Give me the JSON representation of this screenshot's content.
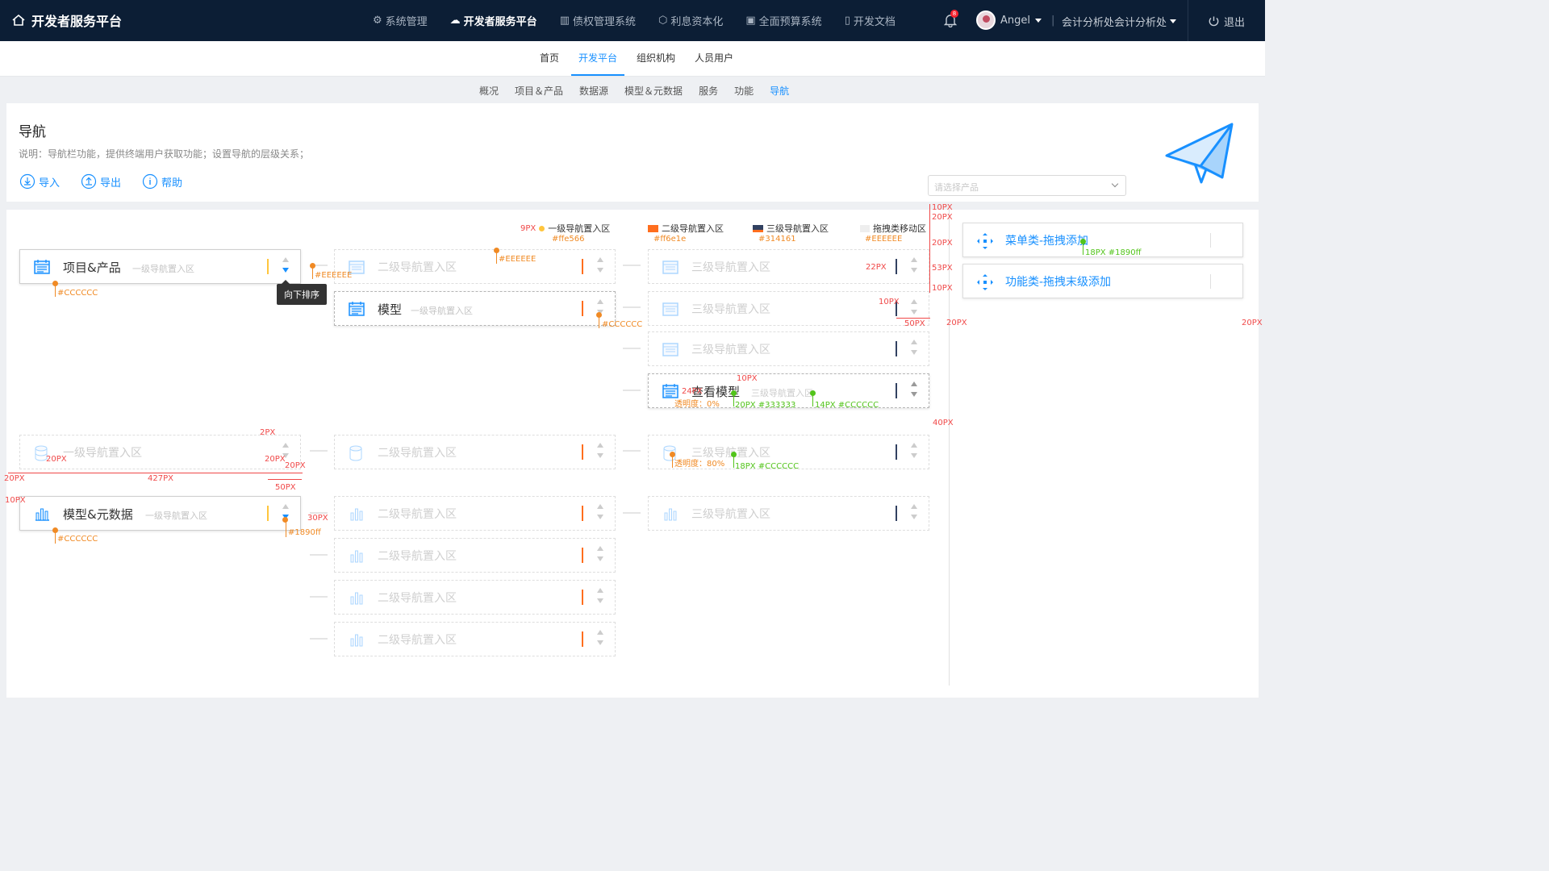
{
  "app": {
    "title": "开发者服务平台",
    "notif_count": "8",
    "user": "Angel",
    "org": "会计分析处会计分析处",
    "logout": "退出",
    "nav": [
      {
        "label": "系统管理",
        "icon": "gear-icon"
      },
      {
        "label": "开发者服务平台",
        "icon": "cloud-icon",
        "active": true
      },
      {
        "label": "债权管理系统",
        "icon": "building-icon"
      },
      {
        "label": "利息资本化",
        "icon": "cube-icon"
      },
      {
        "label": "全面预算系统",
        "icon": "box-icon"
      },
      {
        "label": "开发文档",
        "icon": "document-icon"
      }
    ]
  },
  "subnav1": [
    "首页",
    "开发平台",
    "组织机构",
    "人员用户"
  ],
  "subnav2": [
    "概况",
    "项目＆产品",
    "数据源",
    "模型＆元数据",
    "服务",
    "功能",
    "导航"
  ],
  "header": {
    "title": "导航",
    "desc": "说明：导航栏功能，提供终端用户获取功能；设置导航的层级关系；",
    "import": "导入",
    "export": "导出",
    "help": "帮助",
    "select_placeholder": "请选择产品"
  },
  "legend": {
    "l1": "一级导航置入区",
    "l2": "二级导航置入区",
    "l3": "三级导航置入区",
    "drag": "拖拽类移动区"
  },
  "nodes": {
    "p1_name": "项目&产品",
    "p1_sub": "一级导航置入区",
    "m_name": "模型",
    "m_sub": "一级导航置入区",
    "v_name": "查看模型",
    "v_sub": "三级导航置入区",
    "p3_name": "模型&元数据",
    "p3_sub": "一级导航置入区",
    "ghost_l1": "一级导航置入区",
    "ghost_l2": "二级导航置入区",
    "ghost_l3": "三级导航置入区"
  },
  "tooltip": "向下排序",
  "drag": {
    "menu": "菜单类-拖拽添加",
    "func": "功能类-拖拽末级添加"
  },
  "annotations": {
    "c_ffe566": "#ffe566",
    "c_ffe1e": "#ff6e1e",
    "c_314161": "#314161",
    "c_eee": "#EEEEEE",
    "c_ccc": "#CCCCCC",
    "c_blue": "#1890ff",
    "c_ccc_lower": "#cccccc",
    "fs18": "18PX #1890ff",
    "fs20": "20PX #333333",
    "fs14": "14PX #CCCCCC",
    "fs18c": "18PX #CCCCCC",
    "op0": "透明度：0%",
    "op80": "透明度：80%",
    "px9": "9PX",
    "px10": "10PX",
    "px20": "20PX",
    "px53": "53PX",
    "px22": "22PX",
    "px50": "50PX",
    "px24": "24PX",
    "px40": "40PX",
    "px2": "2PX",
    "px427": "427PX",
    "px30": "30PX"
  },
  "colors": {
    "accent": "#1890ff",
    "topbar": "#0c1e35",
    "annotation": "#f08a24",
    "measure": "#f04848",
    "spec": "#52c41a"
  }
}
